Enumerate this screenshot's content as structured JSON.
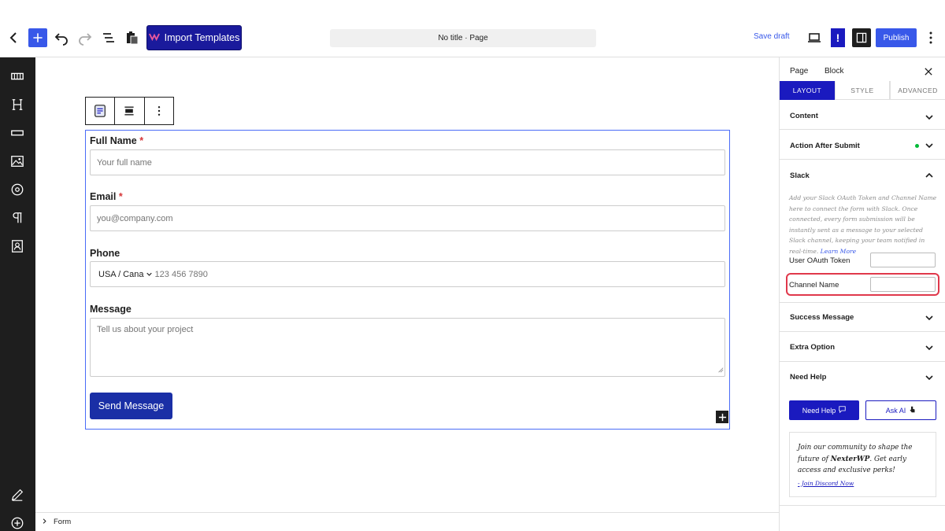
{
  "topbar": {
    "import_label": "Import Templates",
    "doc_title": "No title · Page",
    "save_draft": "Save draft",
    "notice": "!",
    "publish": "Publish",
    "accent": "#3858e9",
    "brand": "#1a1abf"
  },
  "form": {
    "fields": [
      {
        "label": "Full Name",
        "required": "*",
        "placeholder": "Your full name"
      },
      {
        "label": "Email",
        "required": "*",
        "placeholder": "you@company.com"
      },
      {
        "label": "Phone",
        "country": "USA / Cana",
        "placeholder": "123 456 7890"
      },
      {
        "label": "Message",
        "placeholder": "Tell us about your project"
      }
    ],
    "submit_label": "Send Message"
  },
  "breadcrumb": {
    "item": "Form"
  },
  "panel": {
    "tabs": [
      "Page",
      "Block"
    ],
    "sub_tabs": [
      "LAYOUT",
      "STYLE",
      "ADVANCED"
    ],
    "sections": {
      "content": "Content",
      "action_after_submit": "Action After Submit",
      "slack": "Slack",
      "success_message": "Success Message",
      "extra_option": "Extra Option",
      "need_help": "Need Help"
    },
    "slack_description": "Add your Slack OAuth Token and Channel Name here to connect the form with Slack. Once connected, every form submission will be instantly sent as a message to your selected Slack channel, keeping your team notified in real-time.",
    "learn_more": "Learn More",
    "user_oauth_label": "User OAuth Token",
    "user_oauth_value": "",
    "channel_name_label": "Channel Name",
    "channel_name_value": "",
    "need_help_button": "Need Help",
    "ask_ai_button": "Ask AI",
    "community_text_1": "Join our community to shape the future of ",
    "community_brand": "NexterWP",
    "community_text_2": ". Get early access and exclusive perks!",
    "discord_link": "- Join Discord Now"
  }
}
